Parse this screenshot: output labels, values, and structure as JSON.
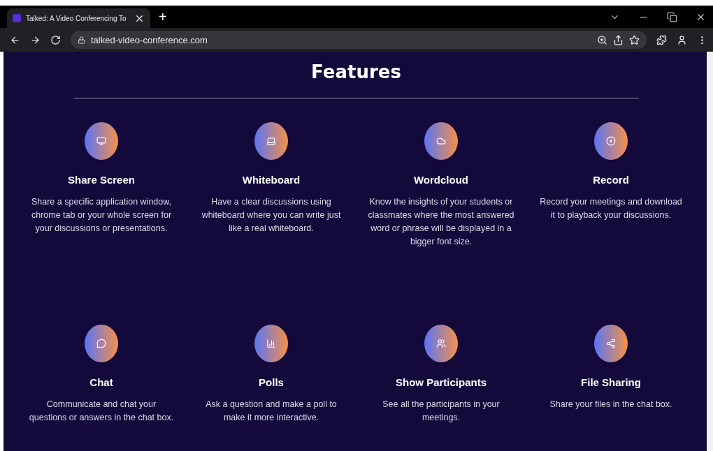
{
  "browser": {
    "tab_title": "Talked: A Video Conferencing To",
    "new_tab": "+",
    "url": "talked-video-conference.com"
  },
  "section": {
    "title": "Features",
    "features": [
      {
        "title": "Share Screen",
        "description": "Share a specific application window, chrome tab or your whole screen for your discussions or presentations."
      },
      {
        "title": "Whiteboard",
        "description": "Have a clear discussions using whiteboard where you can write just like a real whiteboard."
      },
      {
        "title": "Wordcloud",
        "description": "Know the insights of your students or classmates where the most answered word or phrase will be displayed in a bigger font size."
      },
      {
        "title": "Record",
        "description": "Record your meetings and download it to playback your discussions."
      },
      {
        "title": "Chat",
        "description": "Communicate and chat your questions or answers in the chat box."
      },
      {
        "title": "Polls",
        "description": "Ask a question and make a poll to make it more interactive."
      },
      {
        "title": "Show Participants",
        "description": "See all the participants in your meetings."
      },
      {
        "title": "File Sharing",
        "description": "Share your files in the chat box."
      }
    ]
  }
}
